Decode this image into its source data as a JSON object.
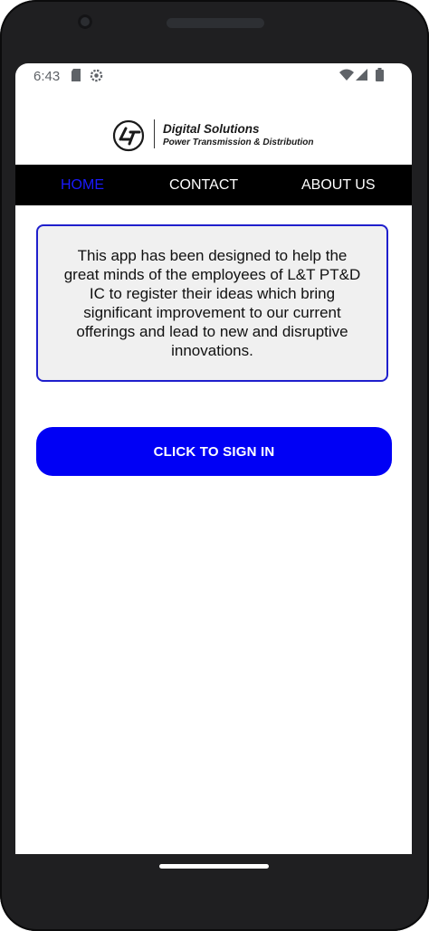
{
  "status_bar": {
    "time": "6:43",
    "left_icons": [
      "sd-card-icon",
      "settings-gear-icon"
    ],
    "right_icons": [
      "wifi-icon",
      "signal-icon",
      "battery-icon"
    ]
  },
  "header": {
    "logo_mark": "L&T logo",
    "logo_title": "Digital Solutions",
    "logo_subtitle": "Power Transmission & Distribution"
  },
  "nav": {
    "items": [
      {
        "label": "HOME",
        "active": true
      },
      {
        "label": "CONTACT",
        "active": false
      },
      {
        "label": "ABOUT US",
        "active": false
      }
    ],
    "active_color": "#1a1aff",
    "background": "#000000"
  },
  "main": {
    "info_text": "This app has been designed to help the great minds of the employees of L&T PT&D IC to register their ideas which bring significant improvement to our current offerings and lead to new and disruptive innovations.",
    "signin_label": "CLICK TO SIGN IN",
    "signin_color": "#0000f5"
  }
}
